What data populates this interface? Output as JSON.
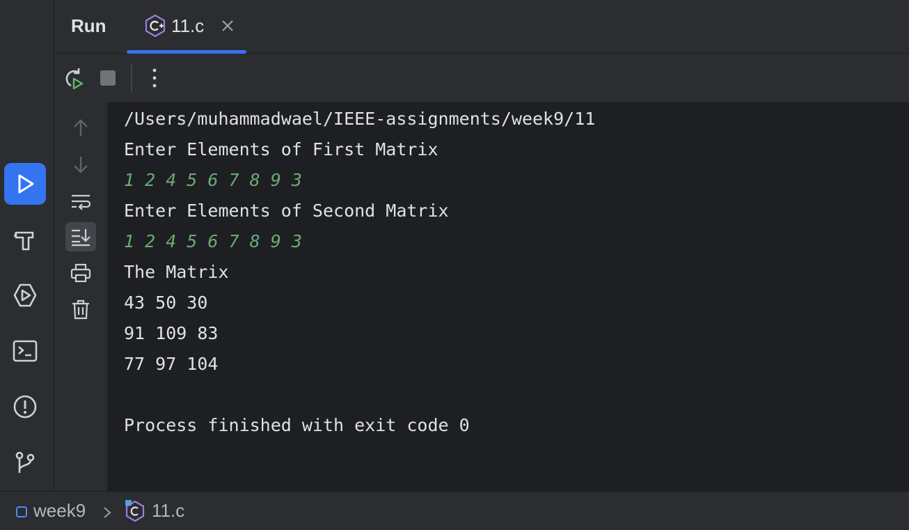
{
  "tool_window": {
    "title": "Run",
    "tab": {
      "label": "11.c",
      "icon": "c-file-icon"
    }
  },
  "activity_bar": {
    "items": [
      {
        "icon": "run-icon",
        "active": true
      },
      {
        "icon": "build-hammer-icon"
      },
      {
        "icon": "services-icon"
      },
      {
        "icon": "terminal-icon"
      },
      {
        "icon": "problems-icon"
      },
      {
        "icon": "git-icon"
      }
    ]
  },
  "toolbar": {
    "items": [
      "rerun-icon",
      "stop-icon",
      "more-icon"
    ]
  },
  "side_tools": {
    "items": [
      "up-arrow-icon",
      "down-arrow-icon",
      "soft-wrap-icon",
      "scroll-to-end-icon",
      "print-icon",
      "trash-icon"
    ]
  },
  "console": {
    "lines": [
      {
        "text": "/Users/muhammadwael/IEEE-assignments/week9/11",
        "type": "output"
      },
      {
        "text": "Enter Elements of First Matrix",
        "type": "output"
      },
      {
        "text": "1 2 4 5 6 7 8 9 3",
        "type": "input"
      },
      {
        "text": "Enter Elements of Second Matrix",
        "type": "output"
      },
      {
        "text": "1 2 4 5 6 7 8 9 3",
        "type": "input"
      },
      {
        "text": "The Matrix",
        "type": "output"
      },
      {
        "text": "43 50 30",
        "type": "output"
      },
      {
        "text": "91 109 83",
        "type": "output"
      },
      {
        "text": "77 97 104",
        "type": "output"
      },
      {
        "text": "",
        "type": "output"
      },
      {
        "text": "Process finished with exit code 0",
        "type": "output"
      }
    ]
  },
  "statusbar": {
    "breadcrumb": [
      {
        "label": "week9",
        "icon": "folder-icon"
      },
      {
        "label": "11.c",
        "icon": "c-file-icon"
      }
    ]
  },
  "colors": {
    "accent": "#3574f0",
    "console_bg": "#1e1f22",
    "panel_bg": "#2b2d30",
    "input_text": "#6aab73",
    "c_icon": "#9b7fdb"
  }
}
